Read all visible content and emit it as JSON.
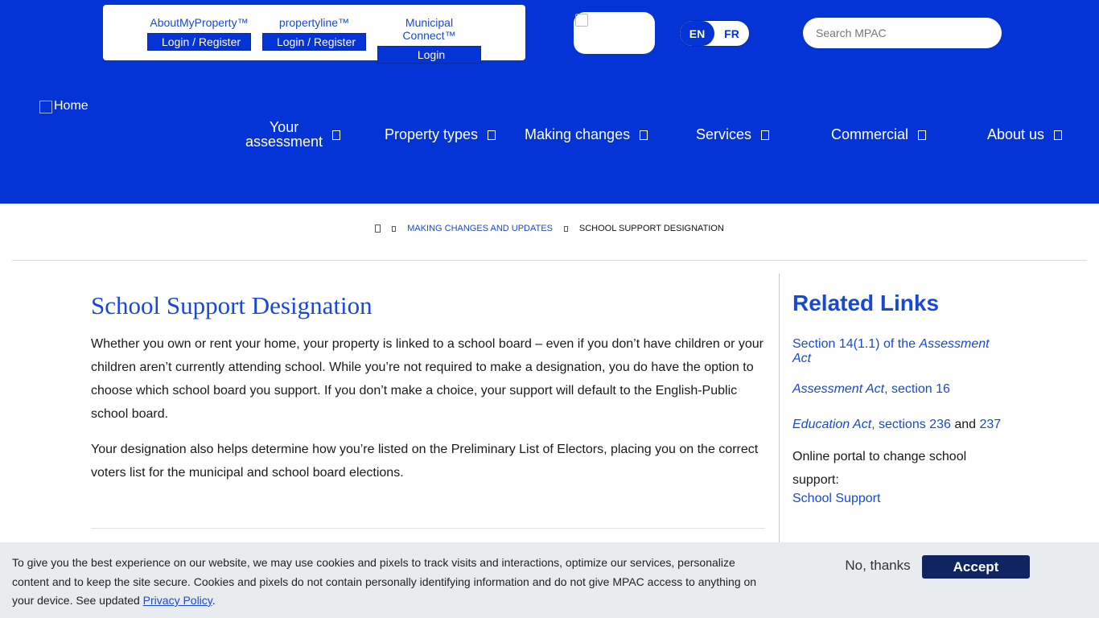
{
  "header": {
    "portals": [
      {
        "title": "AboutMyProperty™",
        "button": "Login / Register",
        "icon": "user-icon",
        "glyph": ""
      },
      {
        "title": "propertyline™",
        "button": "Login / Register",
        "icon": "user-icon",
        "glyph": ""
      },
      {
        "title": "Municipal Connect™",
        "button": "Login",
        "icon": "user-icon",
        "glyph": ""
      }
    ],
    "lang": {
      "en": "EN",
      "fr": "FR"
    },
    "search_placeholder": "Search MPAC",
    "home_alt": "Home"
  },
  "nav": [
    {
      "line1": "Your",
      "line2": "assessment"
    },
    {
      "label": "Property types"
    },
    {
      "label": "Making changes"
    },
    {
      "label": "Services"
    },
    {
      "label": "Commercial"
    },
    {
      "label": "About us"
    }
  ],
  "breadcrumb": {
    "link": "Making changes and updates",
    "current": "School support designation"
  },
  "main": {
    "title": "School Support Designation",
    "para1": "Whether you own or rent your home, your property is linked to a school board – even if you don’t have children or your children aren’t currently attending school. While you’re not required to make a designation, you do have the option to choose which school board you support. If you don’t make a choice, your support will default to the English-Public school board.",
    "para2": "Your designation also helps determine how you’re listed on the Preliminary List of Electors, placing you on the correct voters list for the municipal and school board elections."
  },
  "aside": {
    "title": "Related Links",
    "link1_a": "Section 14(1.1) of the ",
    "link1_b": "Assessment Act",
    "link2_a": "Assessment Act",
    "link2_b": ", section 16",
    "link3_a": "Education Act",
    "link3_b": ", sections 236",
    "link3_and": " and ",
    "link3_c": "237",
    "portal_note": "Online portal to change school support:",
    "school_link": "School Support"
  },
  "cookie": {
    "text": "To give you the best experience on our website, we may use cookies and pixels to track visits and interactions, optimize our services, personalize content and to keep the site secure. Cookies and pixels do not contain personally identifying information and do not give MPAC access to anything on your device. See updated ",
    "link": "Privacy Policy",
    "end": ".",
    "no_thanks": "No, thanks",
    "accept": "Accept"
  }
}
